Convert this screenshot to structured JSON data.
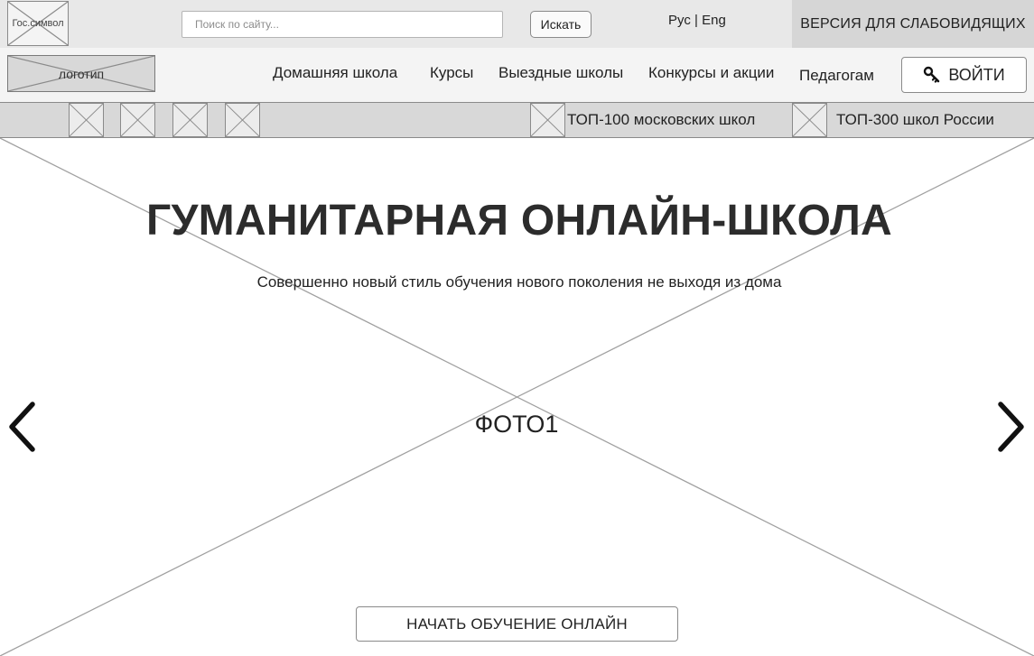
{
  "topbar": {
    "gos_symbol_label": "Гос.символ",
    "search_placeholder": "Поиск по сайту...",
    "search_button_label": "Искать",
    "lang_ru": "Рус",
    "lang_separator": "|",
    "lang_en": "Eng",
    "accessibility_label": "ВЕРСИЯ ДЛЯ СЛАБОВИДЯЩИХ"
  },
  "navbar": {
    "logo_label": "логотип",
    "items": [
      {
        "label": "Домашняя школа"
      },
      {
        "label": "Курсы"
      },
      {
        "label": "Выездные школы"
      },
      {
        "label": "Конкурсы и акции"
      },
      {
        "label": "Педагогам"
      }
    ],
    "login_label": "ВОЙТИ",
    "login_icon": "key-icon"
  },
  "strip": {
    "icons": [
      "placeholder-image",
      "placeholder-image",
      "placeholder-image",
      "placeholder-image"
    ],
    "links": [
      {
        "label": "ТОП-100 московских школ"
      },
      {
        "label": "ТОП-300 школ России"
      }
    ]
  },
  "hero": {
    "title": "ГУМАНИТАРНАЯ ОНЛАЙН-ШКОЛА",
    "subtitle": "Совершенно новый стиль обучения нового поколения не выходя из дома",
    "photo_label": "ФОТО1",
    "prev_icon": "chevron-left-icon",
    "next_icon": "chevron-right-icon",
    "start_button_label": "НАЧАТЬ ОБУЧЕНИЕ ОНЛАЙН"
  }
}
